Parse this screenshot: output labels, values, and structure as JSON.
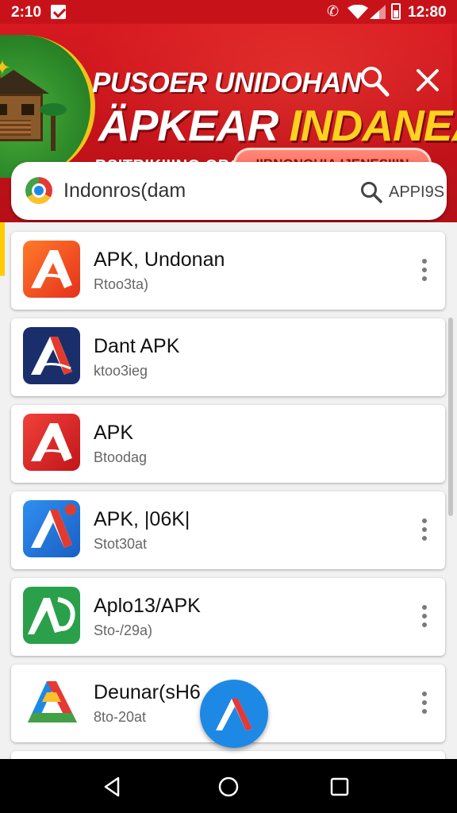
{
  "status_bar": {
    "time": "2:10",
    "clock": "12:80",
    "vibrate_icon": "vibrate-icon"
  },
  "banner": {
    "title_line1": "PUSOER UNIDOHAN",
    "title_line2_white": "ÄPKEAR ",
    "title_line2_yellow": "INDANEAA!",
    "subtitle": "BSITRIKIIINO OBGH",
    "pill_label": "IIBNONOHIA IJENESIIIN",
    "accent_color": "#c8121a",
    "highlight_color": "#ffd21f"
  },
  "search": {
    "value": "Indonros(dam",
    "right_label": "APPI9S"
  },
  "apps": [
    {
      "name": "APK, Undonan",
      "sub": "Rtoo3ta)",
      "icon": "apk-orange-icon",
      "menu": true
    },
    {
      "name": "Dant APK",
      "sub": "ktoo3ieg",
      "icon": "apk-navy-icon",
      "menu": false
    },
    {
      "name": "APK",
      "sub": "Btoodag",
      "icon": "apk-red-icon",
      "menu": false
    },
    {
      "name": "APK, |06K|",
      "sub": "Stot30at",
      "icon": "apk-blue-icon",
      "menu": true
    },
    {
      "name": "Aplo13/APK",
      "sub": "Sto-/29a)",
      "icon": "apk-green-icon",
      "menu": true
    },
    {
      "name": "Deunar(sH6",
      "sub": "8to-20at",
      "icon": "apk-multicolor-icon",
      "menu": true
    }
  ],
  "fab_icon": "apk-logo-icon",
  "nav": {
    "back_icon": "back-icon",
    "home_icon": "home-icon",
    "recents_icon": "recents-icon"
  }
}
